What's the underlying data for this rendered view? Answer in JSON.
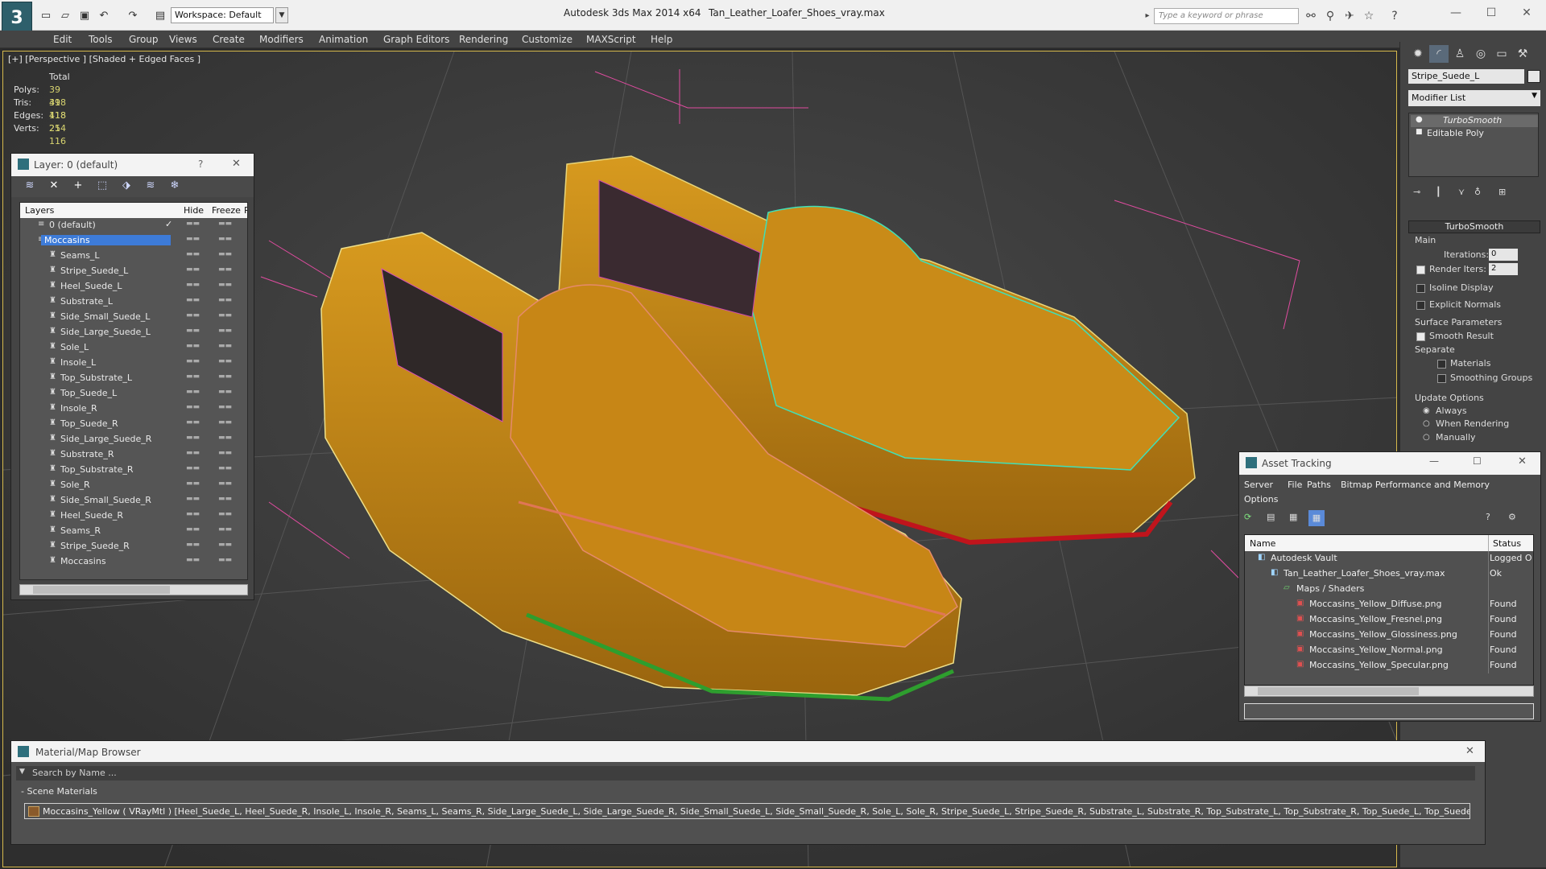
{
  "app": {
    "title": "Autodesk 3ds Max  2014 x64",
    "file": "Tan_Leather_Loafer_Shoes_vray.max",
    "workspace": "Workspace: Default",
    "search_placeholder": "Type a keyword or phrase"
  },
  "menu": [
    "Edit",
    "Tools",
    "Group",
    "Views",
    "Create",
    "Modifiers",
    "Animation",
    "Graph Editors",
    "Rendering",
    "Customize",
    "MAXScript",
    "Help"
  ],
  "viewport": {
    "label": "[+] [Perspective ] [Shaded + Edged Faces ]",
    "stats": {
      "header": "Total",
      "rows": [
        {
          "label": "Polys:",
          "value": "39 418"
        },
        {
          "label": "Tris:",
          "value": "39 418"
        },
        {
          "label": "Edges:",
          "value": "118 254"
        },
        {
          "label": "Verts:",
          "value": "21 116"
        }
      ]
    }
  },
  "layer_dialog": {
    "title": "Layer: 0 (default)",
    "help": "?",
    "columns": {
      "layers": "Layers",
      "hide": "Hide",
      "freeze": "Freeze",
      "render": "R"
    },
    "rows": [
      {
        "name": "0 (default)",
        "level": 0,
        "checked": true
      },
      {
        "name": "Moccasins",
        "level": 0,
        "selected": true
      },
      {
        "name": "Seams_L",
        "level": 1
      },
      {
        "name": "Stripe_Suede_L",
        "level": 1
      },
      {
        "name": "Heel_Suede_L",
        "level": 1
      },
      {
        "name": "Substrate_L",
        "level": 1
      },
      {
        "name": "Side_Small_Suede_L",
        "level": 1
      },
      {
        "name": "Side_Large_Suede_L",
        "level": 1
      },
      {
        "name": "Sole_L",
        "level": 1
      },
      {
        "name": "Insole_L",
        "level": 1
      },
      {
        "name": "Top_Substrate_L",
        "level": 1
      },
      {
        "name": "Top_Suede_L",
        "level": 1
      },
      {
        "name": "Insole_R",
        "level": 1
      },
      {
        "name": "Top_Suede_R",
        "level": 1
      },
      {
        "name": "Side_Large_Suede_R",
        "level": 1
      },
      {
        "name": "Substrate_R",
        "level": 1
      },
      {
        "name": "Top_Substrate_R",
        "level": 1
      },
      {
        "name": "Sole_R",
        "level": 1
      },
      {
        "name": "Side_Small_Suede_R",
        "level": 1
      },
      {
        "name": "Heel_Suede_R",
        "level": 1
      },
      {
        "name": "Seams_R",
        "level": 1
      },
      {
        "name": "Stripe_Suede_R",
        "level": 1
      },
      {
        "name": "Moccasins",
        "level": 1
      }
    ]
  },
  "command_panel": {
    "object_name": "Stripe_Suede_L",
    "modifier_list": "Modifier List",
    "stack": [
      "TurboSmooth",
      "Editable Poly"
    ],
    "turbosmooth": {
      "header": "TurboSmooth",
      "main": "Main",
      "iterations_label": "Iterations:",
      "iterations": "0",
      "render_iters_label": "Render Iters:",
      "render_iters": "2",
      "isoline": "Isoline Display",
      "explicit": "Explicit Normals",
      "surface": "Surface Parameters",
      "smooth_result": "Smooth Result",
      "separate": "Separate",
      "materials": "Materials",
      "smoothing_groups": "Smoothing Groups",
      "update_options": "Update Options",
      "always": "Always",
      "when_rendering": "When Rendering",
      "manually": "Manually"
    }
  },
  "asset_tracking": {
    "title": "Asset Tracking",
    "menu": [
      "Server",
      "File",
      "Paths",
      "Bitmap Performance and Memory",
      "Options"
    ],
    "columns": {
      "name": "Name",
      "status": "Status"
    },
    "rows": [
      {
        "name": "Autodesk Vault",
        "status": "Logged O",
        "indent": 1
      },
      {
        "name": "Tan_Leather_Loafer_Shoes_vray.max",
        "status": "Ok",
        "indent": 2
      },
      {
        "name": "Maps / Shaders",
        "status": "",
        "indent": 3
      },
      {
        "name": "Moccasins_Yellow_Diffuse.png",
        "status": "Found",
        "indent": 4
      },
      {
        "name": "Moccasins_Yellow_Fresnel.png",
        "status": "Found",
        "indent": 4
      },
      {
        "name": "Moccasins_Yellow_Glossiness.png",
        "status": "Found",
        "indent": 4
      },
      {
        "name": "Moccasins_Yellow_Normal.png",
        "status": "Found",
        "indent": 4
      },
      {
        "name": "Moccasins_Yellow_Specular.png",
        "status": "Found",
        "indent": 4
      }
    ]
  },
  "material_browser": {
    "title": "Material/Map Browser",
    "search": "Search by Name ...",
    "group": "- Scene Materials",
    "item": "Moccasins_Yellow  ( VRayMtl ) [Heel_Suede_L, Heel_Suede_R, Insole_L, Insole_R, Seams_L, Seams_R, Side_Large_Suede_L, Side_Large_Suede_R, Side_Small_Suede_L, Side_Small_Suede_R, Sole_L, Sole_R, Stripe_Suede_L, Stripe_Suede_R, Substrate_L, Substrate_R, Top_Substrate_L, Top_Substrate_R, Top_Suede_L, Top_Suede_R]"
  }
}
